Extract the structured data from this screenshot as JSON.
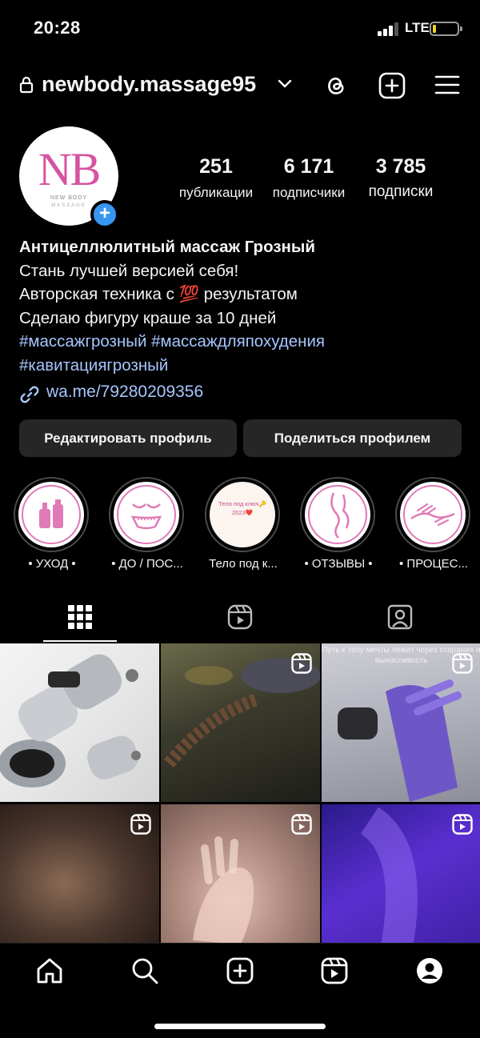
{
  "status_bar": {
    "time": "20:28",
    "network": "LTE"
  },
  "header": {
    "username": "newbody.massage95"
  },
  "profile": {
    "avatar_logo": "NB",
    "avatar_sub": "NEW BODY",
    "avatar_sub2": "MASSAGE",
    "stats": [
      {
        "value": "251",
        "label": "публикации"
      },
      {
        "value": "6 171",
        "label": "подписчики"
      },
      {
        "value": "3 785",
        "label": "подписки"
      }
    ],
    "bio": {
      "name": "Антицеллюлитный массаж Грозный",
      "line1": "Стань лучшей версией себя!",
      "line2": "Авторская техника с 💯 результатом",
      "line3": "Сделаю фигуру краше за 10 дней",
      "hashtags1": "#массажгрозный #массаждляпохудения",
      "hashtags2": "#кавитациягрозный"
    },
    "link": "wa.me/79280209356"
  },
  "buttons": {
    "edit": "Редактировать профиль",
    "share": "Поделиться профилем"
  },
  "highlights": [
    {
      "label": "• УХОД •"
    },
    {
      "label": "• ДО / ПОС..."
    },
    {
      "label": "Тело под к...",
      "cover_text": "Тело под ключ🔑 2023❤️"
    },
    {
      "label": "• ОТЗЫВЫ •"
    },
    {
      "label": "• ПРОЦЕС..."
    }
  ],
  "grid": {
    "caption_3": "Путь к телу мечты лежит через старания и выносливость"
  },
  "colors": {
    "accent": "#3797f0",
    "link": "#a6c6ff",
    "brand_pink": "#d6549f",
    "button_bg": "#262626"
  }
}
